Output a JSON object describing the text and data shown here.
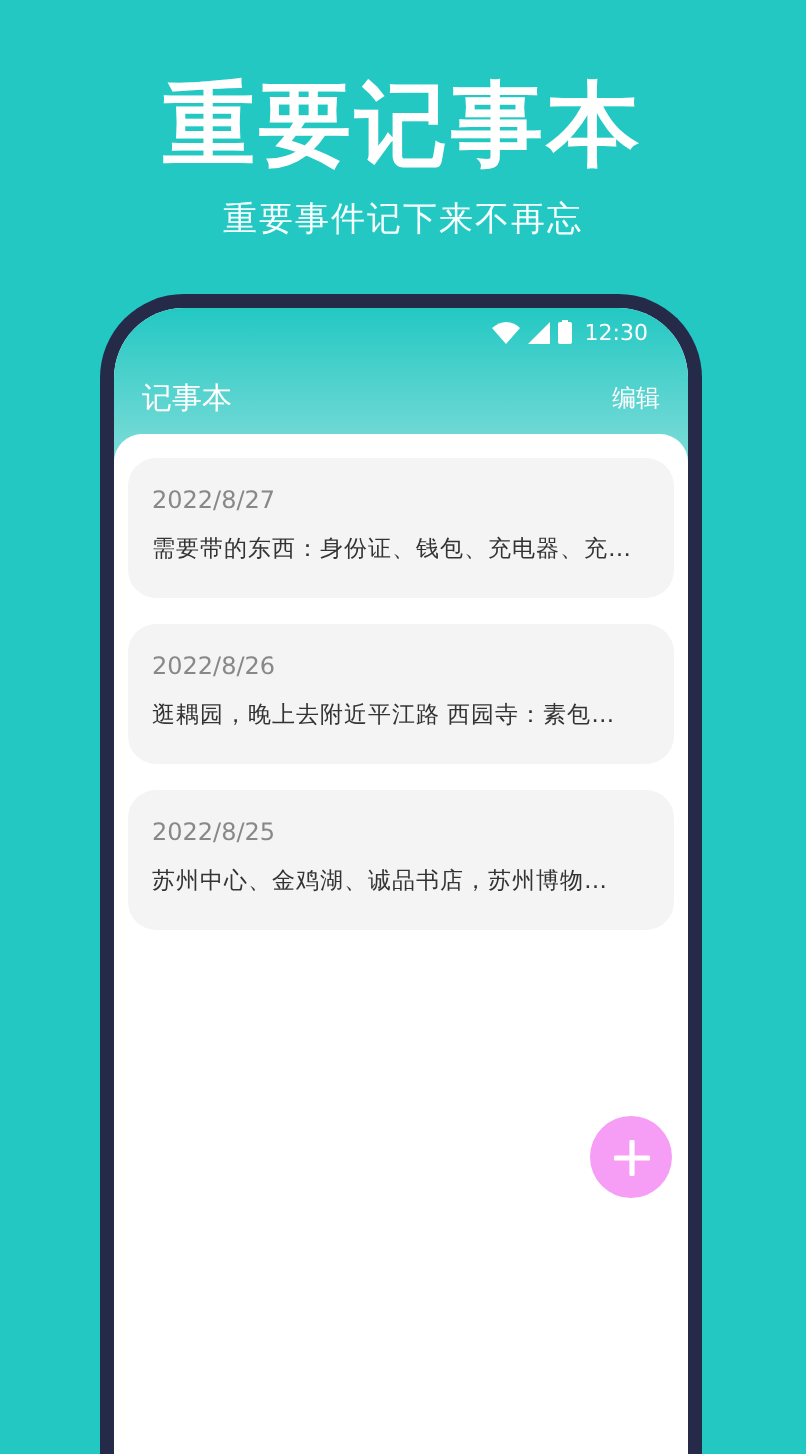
{
  "headline": "重要记事本",
  "subtitle": "重要事件记下来不再忘",
  "status_bar": {
    "time": "12:30"
  },
  "app_bar": {
    "title": "记事本",
    "action": "编辑"
  },
  "notes": [
    {
      "date": "2022/8/27",
      "text": "需要带的东西：身份证、钱包、充电器、充…"
    },
    {
      "date": "2022/8/26",
      "text": "逛耦园，晚上去附近平江路  西园寺：素包…"
    },
    {
      "date": "2022/8/25",
      "text": "苏州中心、金鸡湖、诚品书店，苏州博物…"
    }
  ]
}
